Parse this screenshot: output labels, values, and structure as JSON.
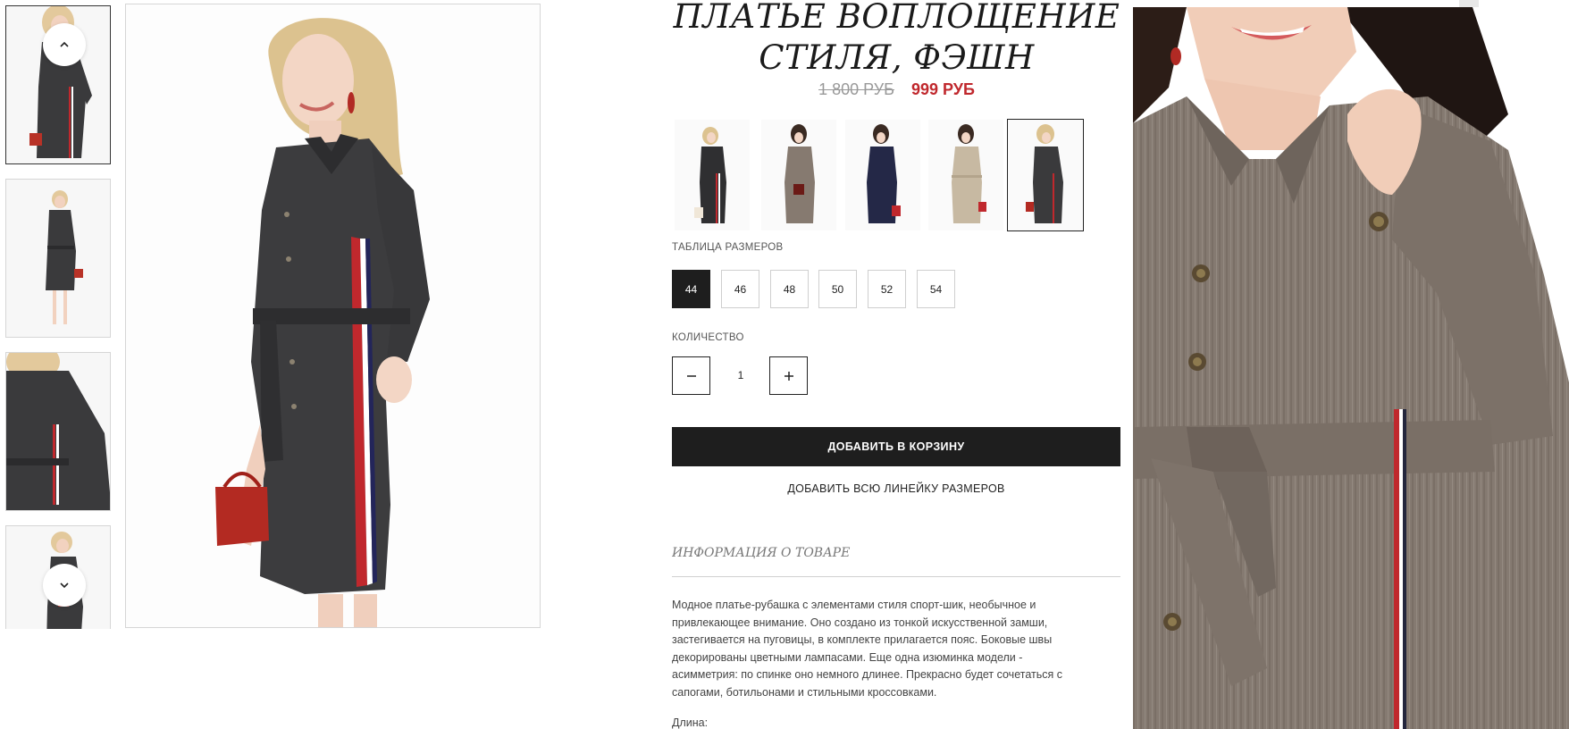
{
  "product": {
    "title_line1": "ПЛАТЬЕ ВОПЛОЩЕНИЕ",
    "title_line2": "СТИЛЯ, ФЭШН",
    "old_price": "1 800 РУБ",
    "new_price": "999 РУБ"
  },
  "gallery": {
    "thumbnails": [
      "thumb-1",
      "thumb-2",
      "thumb-3",
      "thumb-4"
    ],
    "active_thumbnail": 1,
    "up_icon": "chevron-up-icon",
    "down_icon": "chevron-down-icon"
  },
  "colors": {
    "swatches": [
      "black-with-stripes",
      "taupe-grey",
      "navy",
      "beige",
      "dark-grey"
    ],
    "active_swatch": 5
  },
  "sizes": {
    "label": "ТАБЛИЦА РАЗМЕРОВ",
    "options": [
      "44",
      "46",
      "48",
      "50",
      "52",
      "54"
    ],
    "selected": "44"
  },
  "quantity": {
    "label": "КОЛИЧЕСТВО",
    "value": "1",
    "minus_icon": "minus-icon",
    "plus_icon": "plus-icon"
  },
  "actions": {
    "add_to_cart": "ДОБАВИТЬ В КОРЗИНУ",
    "add_all_sizes": "ДОБАВИТЬ ВСЮ ЛИНЕЙКУ РАЗМЕРОВ"
  },
  "info": {
    "heading": "ИНФОРМАЦИЯ О ТОВАРЕ",
    "description_lines": [
      "Модное платье-рубашка с элементами стиля спорт-шик, необычное и",
      "привлекающее внимание. Оно создано из тонкой искусственной замши,",
      "застегивается на пуговицы, в комплекте прилагается пояс. Боковые швы",
      "декорированы цветными лампасами. Еще одна изюминка модели -",
      "асимметрия: по спинке оно немного длинее. Прекрасно будет сочетаться с",
      "сапогами, ботильонами и стильными кроссовками."
    ],
    "length_label": "Длина:"
  },
  "colors_theme": {
    "accent_price": "#c0282d",
    "button_dark": "#1e1e1e",
    "dress_dark": "#3a3a3c",
    "dress_taupe": "#867a70"
  }
}
